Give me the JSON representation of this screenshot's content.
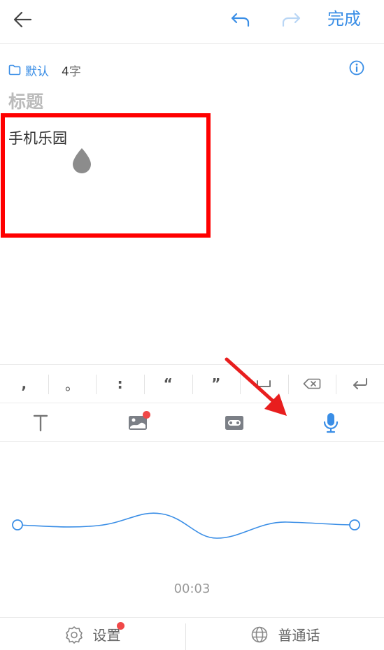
{
  "header": {
    "back_icon": "arrow-left-icon",
    "undo_icon": "undo-icon",
    "redo_icon": "redo-icon",
    "done_label": "完成"
  },
  "meta": {
    "folder_icon": "folder-icon",
    "folder_label": "默认",
    "count_number": "4",
    "count_unit": "字",
    "info_icon": "info-icon"
  },
  "note": {
    "title_placeholder": "标题",
    "body_text": "手机乐园"
  },
  "punctuation": {
    "keys": [
      ",",
      "。",
      ":",
      "“",
      "”",
      "空格",
      "删除",
      "换行"
    ]
  },
  "toolbar": {
    "text_icon": "text-format-icon",
    "image_icon": "image-icon",
    "tape_icon": "cassette-icon",
    "mic_icon": "microphone-icon",
    "image_has_badge": true
  },
  "recording": {
    "elapsed": "00:03"
  },
  "footer": {
    "settings_label": "设置",
    "settings_has_badge": true,
    "language_label": "普通话"
  },
  "colors": {
    "accent": "#3a8ee6",
    "highlight": "#ff0000",
    "badge": "#f04848"
  }
}
